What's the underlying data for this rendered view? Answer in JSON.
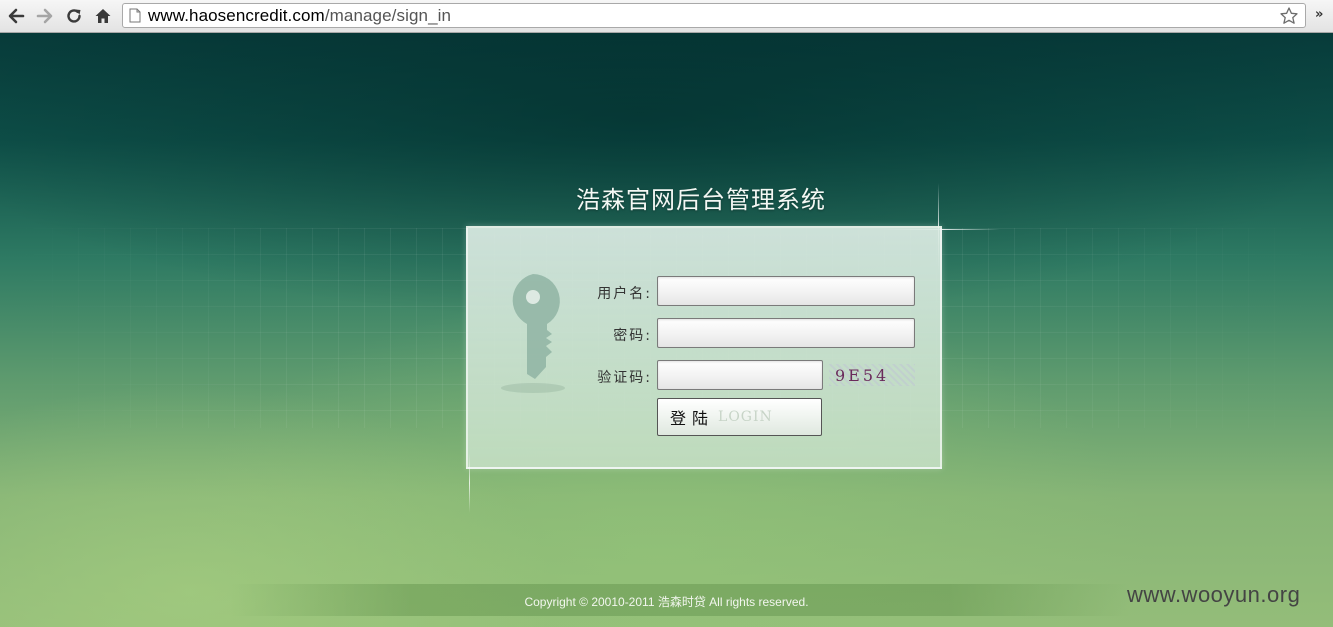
{
  "browser": {
    "url_host": "www.haosencredit.com",
    "url_path": "/manage/sign_in",
    "more_label": "»"
  },
  "page": {
    "title": "浩森官网后台管理系统",
    "form": {
      "username_label": "用户名:",
      "username_value": "",
      "password_label": "密码:",
      "password_value": "",
      "captcha_label": "验证码:",
      "captcha_value": "",
      "captcha_text": "9E54",
      "login_label_cn": "登陆",
      "login_label_en": "LOGIN"
    },
    "footer": {
      "copyright": "Copyright © 20010-2011 浩森时贷 All rights reserved."
    }
  },
  "watermark": "www.wooyun.org"
}
